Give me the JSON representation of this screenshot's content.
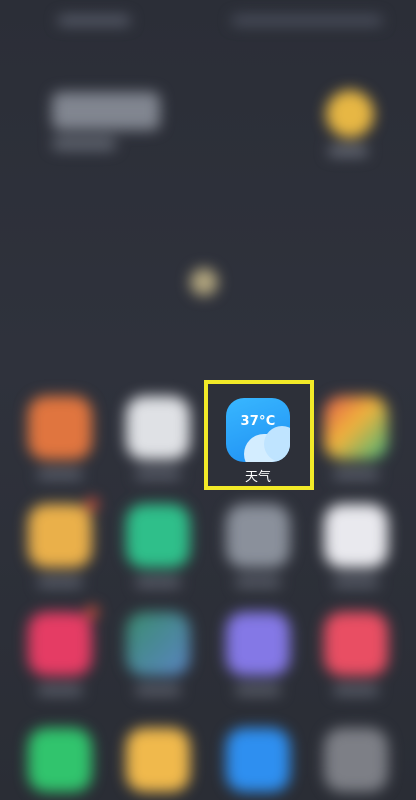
{
  "highlighted_app": {
    "icon_temp": "37°C",
    "label": "天气",
    "highlight_color": "#f2ea28",
    "icon_color": "#2a9cf8"
  },
  "colors": {
    "background": "#2a2d36"
  },
  "icons": {
    "weather": "cloud-temperature-icon"
  }
}
